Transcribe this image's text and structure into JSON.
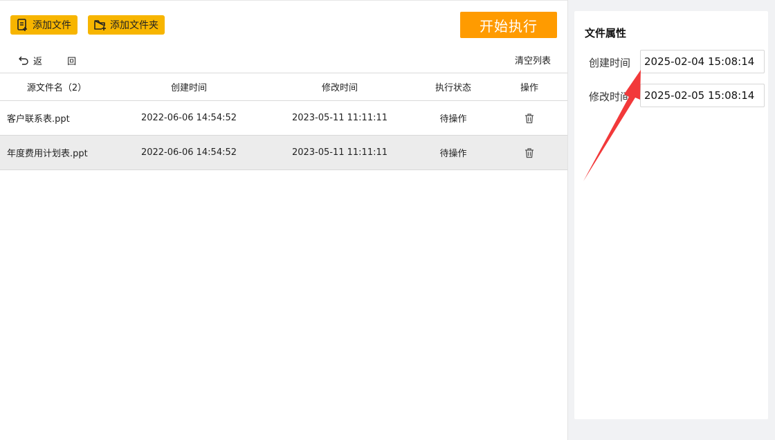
{
  "toolbar": {
    "add_file_label": "添加文件",
    "add_folder_label": "添加文件夹",
    "start_label": "开始执行",
    "back_label": "返 回",
    "clear_label": "清空列表"
  },
  "table": {
    "headers": {
      "name": "源文件名（2）",
      "created": "创建时间",
      "modified": "修改时间",
      "status": "执行状态",
      "op": "操作"
    },
    "rows": [
      {
        "name": "客户联系表.ppt",
        "created": "2022-06-06 14:54:52",
        "modified": "2023-05-11 11:11:11",
        "status": "待操作"
      },
      {
        "name": "年度费用计划表.ppt",
        "created": "2022-06-06 14:54:52",
        "modified": "2023-05-11 11:11:11",
        "status": "待操作"
      }
    ]
  },
  "properties": {
    "title": "文件属性",
    "created_label": "创建时间",
    "created_value": "2025-02-04 15:08:14",
    "modified_label": "修改时间",
    "modified_value": "2025-02-05 15:08:14"
  },
  "icons": {
    "add_file": "file-plus-icon",
    "add_folder": "folder-plus-icon",
    "back": "undo-arrow-icon",
    "delete": "trash-icon",
    "annotation": "red-arrow"
  },
  "colors": {
    "add_button": "#f7b500",
    "start_button": "#ff9b00",
    "selected_row": "#ececec",
    "annotation_arrow": "#f2393a"
  }
}
